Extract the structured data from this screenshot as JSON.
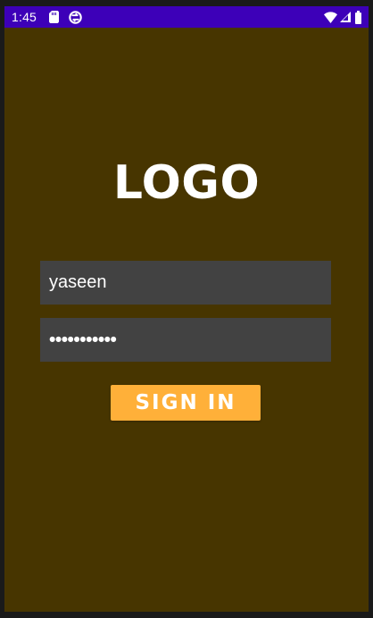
{
  "status_bar": {
    "time": "1:45",
    "icons": [
      "sd-card-icon",
      "sync-icon",
      "wifi-icon",
      "signal-icon",
      "battery-icon"
    ],
    "background_color": "#3d00b8"
  },
  "login": {
    "logo_text": "LOGO",
    "username_value": "yaseen",
    "password_mask": "•••••••••••",
    "sign_in_label": "SIGN IN",
    "background_color": "#473500",
    "field_color": "#424242",
    "button_color": "#ffb039"
  }
}
